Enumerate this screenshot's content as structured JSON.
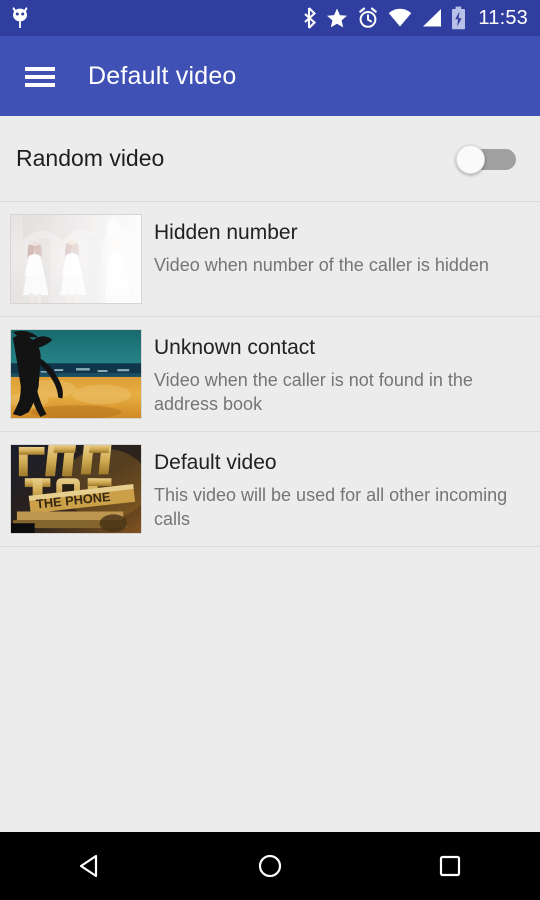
{
  "status_bar": {
    "notification_icon": "android-robot-icon",
    "icons": [
      "bluetooth-icon",
      "star-icon",
      "alarm-icon",
      "wifi-icon",
      "signal-icon",
      "battery-charging-icon"
    ],
    "time": "11:53",
    "background": "#303F9F",
    "foreground": "#FFFFFF"
  },
  "app_bar": {
    "menu_icon": "hamburger-menu-icon",
    "title": "Default video",
    "background": "#3F51B5",
    "foreground": "#FFFFFF"
  },
  "switch_row": {
    "label": "Random video",
    "state": "off",
    "track_color": "#A0A0A0",
    "thumb_color": "#FAFAFA"
  },
  "list": {
    "items": [
      {
        "title": "Hidden number",
        "subtitle": "Video when number of the caller is hidden",
        "thumbnail": "pale-hall-dancers-thumbnail"
      },
      {
        "title": "Unknown contact",
        "subtitle": "Video when the caller is not found in the address book",
        "thumbnail": "beach-horse-silhouette-thumbnail"
      },
      {
        "title": "Default video",
        "subtitle": "This video will be used for all other incoming calls",
        "thumbnail": "gold-logo-the-phone-thumbnail"
      }
    ]
  },
  "nav_bar": {
    "back": "back-triangle-icon",
    "home": "home-circle-icon",
    "recents": "recents-square-icon",
    "background": "#000000"
  },
  "colors": {
    "page_background": "#ECECEC",
    "divider": "#DCDCDC",
    "title_text": "#212121",
    "subtitle_text": "#757575"
  }
}
